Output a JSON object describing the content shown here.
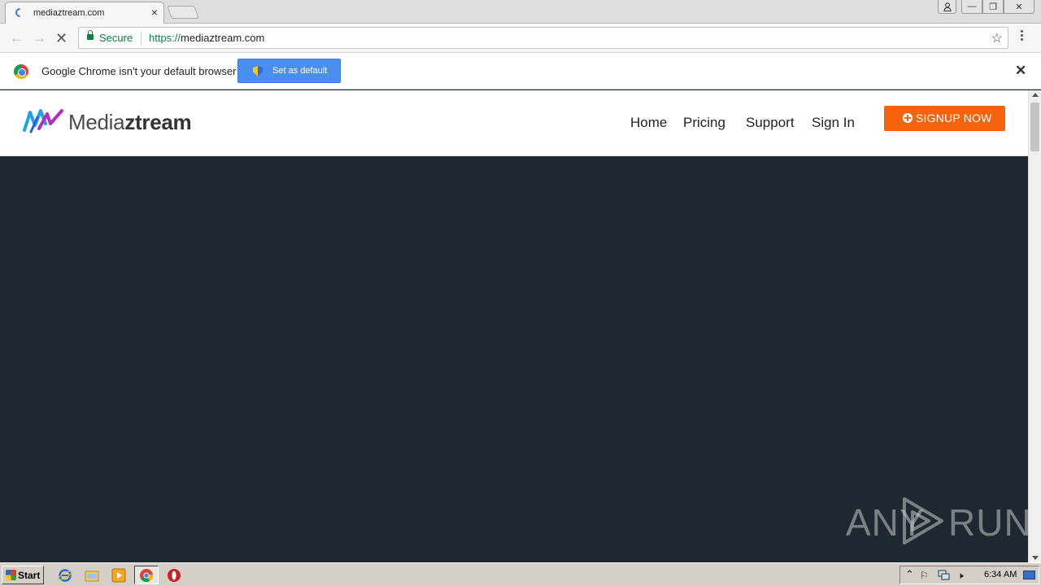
{
  "browser": {
    "tab_title": "mediaztream.com",
    "tab_close": "×",
    "window_controls": {
      "minimize": "—",
      "maximize": "❐",
      "close": "✕"
    },
    "secure_label": "Secure",
    "url_scheme": "https://",
    "url_host": "mediaztream.com",
    "infobar_text": "Google Chrome isn't your default browser",
    "set_default_label": "Set as default",
    "infobar_close": "✕"
  },
  "site": {
    "logo_light": "Media",
    "logo_bold": "ztream",
    "nav": [
      "Home",
      "Pricing",
      "Support",
      "Sign In"
    ],
    "signup_label": "SIGNUP NOW"
  },
  "watermark": {
    "left": "ANY",
    "right": "RUN"
  },
  "taskbar": {
    "start_label": "Start",
    "clock": "6:34 AM"
  },
  "colors": {
    "accent_orange": "#f7630c",
    "page_dark": "#1e2830",
    "infobar_button": "#4a8ef0",
    "secure_green": "#0b8043"
  },
  "icons": [
    "tab-loading-icon",
    "back-icon",
    "forward-icon",
    "stop-icon",
    "lock-icon",
    "star-icon",
    "chrome-menu-icon",
    "chrome-logo-icon",
    "shield-icon",
    "close-icon",
    "plus-circle-icon",
    "ie-icon",
    "folder-icon",
    "media-player-icon",
    "chrome-icon",
    "opera-icon"
  ]
}
